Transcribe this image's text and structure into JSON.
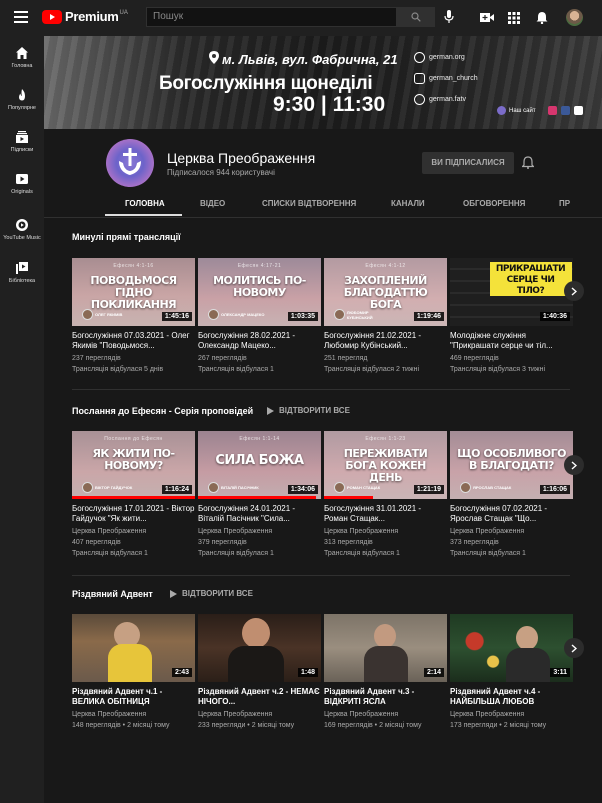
{
  "header": {
    "logo_text": "Premium",
    "logo_region": "UA",
    "search_placeholder": "Пошук"
  },
  "sidebar": {
    "items": [
      {
        "label": "Головна",
        "icon": "home-icon"
      },
      {
        "label": "Популярне",
        "icon": "flame-icon"
      },
      {
        "label": "Підписки",
        "icon": "subscriptions-icon"
      },
      {
        "label": "Originals",
        "icon": "originals-icon"
      },
      {
        "label": "YouTube Music",
        "icon": "music-icon"
      },
      {
        "label": "Бібліотека",
        "icon": "library-icon"
      }
    ]
  },
  "banner": {
    "address": "м. Львів, вул. Фабрична, 21",
    "title": "Богослужіння щонеділі",
    "time": "9:30 | 11:30",
    "web": "german.org",
    "instagram": "german_church",
    "facebook": "german.fatv",
    "site_label": "Наш сайт"
  },
  "channel": {
    "name": "Церква Преображення",
    "subscribers": "Підписалося 944 користувачі",
    "subscribe_label": "ВИ ПІДПИСАЛИСЯ"
  },
  "tabs": [
    "ГОЛОВНА",
    "ВІДЕО",
    "СПИСКИ ВІДТВОРЕННЯ",
    "КАНАЛИ",
    "ОБГОВОРЕННЯ",
    "ПР"
  ],
  "shelves": [
    {
      "title": "Минулі прямі трансляції",
      "play_all": "",
      "videos": [
        {
          "thumb_ref": "Ефесян 4:1-16",
          "thumb_text": "ПОВОДЬМОСЯ ГІДНО ПОКЛИКАННЯ",
          "speaker": "ОЛЕГ ЯКИМІВ",
          "duration": "1:45:16",
          "title": "Богослужіння 07.03.2021 - Олег Якимів \"Поводьмося...",
          "line1": "237 переглядів",
          "line2": "Трансляція відбулася 5 днів"
        },
        {
          "thumb_ref": "Ефесян 4:17-21",
          "thumb_text": "МОЛИТИСЬ ПО-НОВОМУ",
          "speaker": "ОЛЕКСАНДР МАЦЕКО",
          "duration": "1:03:35",
          "title": "Богослужіння 28.02.2021 - Олександр Мацеко...",
          "line1": "267 переглядів",
          "line2": "Трансляція відбулася 1"
        },
        {
          "thumb_ref": "Ефесян 4:1-12",
          "thumb_text": "ЗАХОПЛЕНИЙ БЛАГОДАТТЮ БОГА",
          "speaker": "ЛЮБОМИР КУБІНСЬКИЙ",
          "duration": "1:19:46",
          "title": "Богослужіння 21.02.2021 - Любомир Кубінський...",
          "line1": "251 перегляд",
          "line2": "Трансляція відбулася 2 тижні"
        },
        {
          "thumb_ref": "",
          "thumb_text": "ПРИКРАШАТИ СЕРЦЕ ЧИ ТІЛО?",
          "speaker": "",
          "duration": "1:40:36",
          "title": "Молодіжне служіння \"Прикрашати серце чи тіл...",
          "line1": "469 переглядів",
          "line2": "Трансляція відбулася 3 тижні"
        }
      ]
    },
    {
      "title": "Послання до Ефесян - Серія проповідей",
      "play_all": "ВІДТВОРИТИ ВСЕ",
      "videos": [
        {
          "thumb_ref": "Послання до Ефесян",
          "thumb_text": "ЯК ЖИТИ ПО-НОВОМУ?",
          "speaker": "ВІКТОР ГАЙДУЧОК",
          "duration": "1:16:24",
          "title": "Богослужіння 17.01.2021 - Віктор Гайдучок \"Як жити...",
          "line1": "Церква Преображення",
          "line2": "407 переглядів",
          "line3": "Трансляція відбулася 1"
        },
        {
          "thumb_ref": "Ефесян 1:1-14",
          "thumb_text": "СИЛА БОЖА",
          "speaker": "ВІТАЛІЙ ПАСІЧНИК",
          "duration": "1:34:06",
          "title": "Богослужіння 24.01.2021 - Віталій Пасічник \"Сила...",
          "line1": "Церква Преображення",
          "line2": "379 переглядів",
          "line3": "Трансляція відбулася 1"
        },
        {
          "thumb_ref": "Ефесян 1:1-23",
          "thumb_text": "ПЕРЕЖИВАТИ БОГА КОЖЕН ДЕНЬ",
          "speaker": "РОМАН СТАЩАК",
          "duration": "1:21:19",
          "title": "Богослужіння 31.01.2021 - Роман Стащак...",
          "line1": "Церква Преображення",
          "line2": "313 переглядів",
          "line3": "Трансляція відбулася 1"
        },
        {
          "thumb_ref": "",
          "thumb_text": "ЩО ОСОБЛИВОГО В БЛАГОДАТІ?",
          "speaker": "ЯРОСЛАВ СТАЩАК",
          "duration": "1:16:06",
          "title": "Богослужіння 07.02.2021 - Ярослав Стащак \"Що...",
          "line1": "Церква Преображення",
          "line2": "373 переглядів",
          "line3": "Трансляція відбулася 1"
        }
      ]
    },
    {
      "title": "Різдвяний Адвент",
      "play_all": "ВІДТВОРИТИ ВСЕ",
      "videos": [
        {
          "duration": "2:43",
          "title": "Різдвяний Адвент ч.1 - ВЕЛИКА ОБІТНИЦЯ",
          "line1": "Церква Преображення",
          "line2": "148 переглядів • 2 місяці тому"
        },
        {
          "duration": "1:48",
          "title": "Різдвяний Адвент ч.2 - НЕМАЄ НІЧОГО...",
          "line1": "Церква Преображення",
          "line2": "233 перегляди • 2 місяці тому"
        },
        {
          "duration": "2:14",
          "title": "Різдвяний Адвент ч.3 - ВІДКРИТІ ЯСЛА",
          "line1": "Церква Преображення",
          "line2": "169 переглядів • 2 місяці тому"
        },
        {
          "duration": "3:11",
          "title": "Різдвяний Адвент ч.4 - НАЙБІЛЬША ЛЮБОВ",
          "line1": "Церква Преображення",
          "line2": "173 перегляди • 2 місяці тому"
        }
      ]
    }
  ],
  "colors": {
    "accent_red": "#ff0000",
    "background": "#181818",
    "surface": "#202020"
  }
}
